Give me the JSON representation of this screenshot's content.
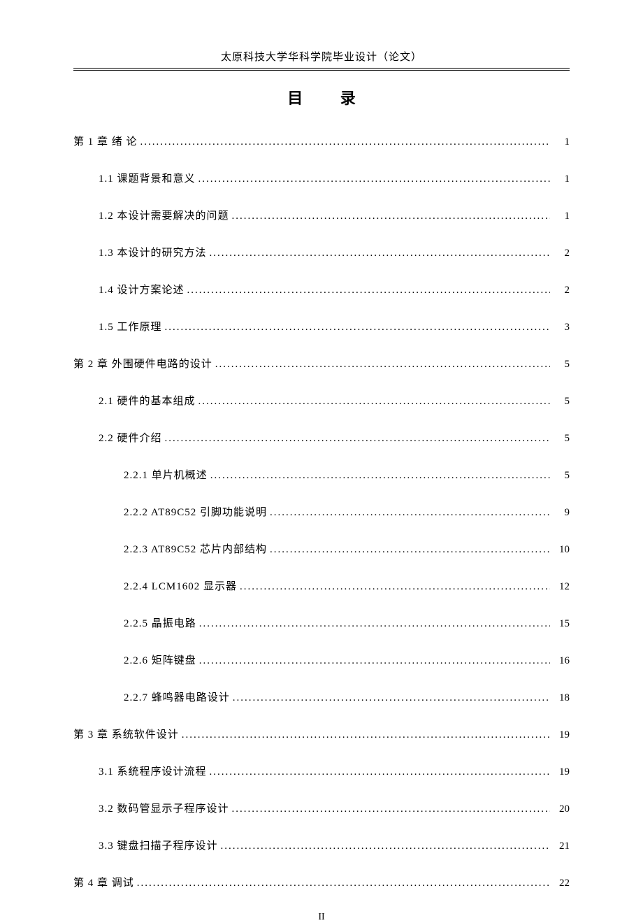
{
  "header": "太原科技大学华科学院毕业设计（论文）",
  "title": "目    录",
  "footer": "II",
  "toc": [
    {
      "level": 0,
      "label": "第 1 章 绪 论",
      "page": "1"
    },
    {
      "level": 1,
      "label": "1.1 课题背景和意义",
      "page": "1"
    },
    {
      "level": 1,
      "label": "1.2 本设计需要解决的问题",
      "page": "1"
    },
    {
      "level": 1,
      "label": "1.3 本设计的研究方法",
      "page": "2"
    },
    {
      "level": 1,
      "label": "1.4 设计方案论述",
      "page": "2"
    },
    {
      "level": 1,
      "label": "1.5 工作原理",
      "page": "3"
    },
    {
      "level": 0,
      "label": "第 2 章 外围硬件电路的设计",
      "page": "5"
    },
    {
      "level": 1,
      "label": "2.1 硬件的基本组成",
      "page": "5"
    },
    {
      "level": 1,
      "label": "2.2 硬件介绍",
      "page": "5"
    },
    {
      "level": 2,
      "label": "2.2.1 单片机概述",
      "page": "5"
    },
    {
      "level": 2,
      "label": "2.2.2 AT89C52 引脚功能说明",
      "page": "9"
    },
    {
      "level": 2,
      "label": "2.2.3 AT89C52 芯片内部结构",
      "page": "10"
    },
    {
      "level": 2,
      "label": "2.2.4 LCM1602 显示器",
      "page": "12"
    },
    {
      "level": 2,
      "label": "2.2.5 晶振电路",
      "page": "15"
    },
    {
      "level": 2,
      "label": "2.2.6 矩阵键盘",
      "page": "16"
    },
    {
      "level": 2,
      "label": "2.2.7 蜂鸣器电路设计",
      "page": "18"
    },
    {
      "level": 0,
      "label": "第 3 章  系统软件设计",
      "page": "19"
    },
    {
      "level": 1,
      "label": "3.1 系统程序设计流程",
      "page": "19"
    },
    {
      "level": 1,
      "label": "3.2 数码管显示子程序设计",
      "page": "20"
    },
    {
      "level": 1,
      "label": "3.3 键盘扫描子程序设计",
      "page": "21"
    },
    {
      "level": 0,
      "label": "第 4 章  调试",
      "page": "22"
    }
  ]
}
